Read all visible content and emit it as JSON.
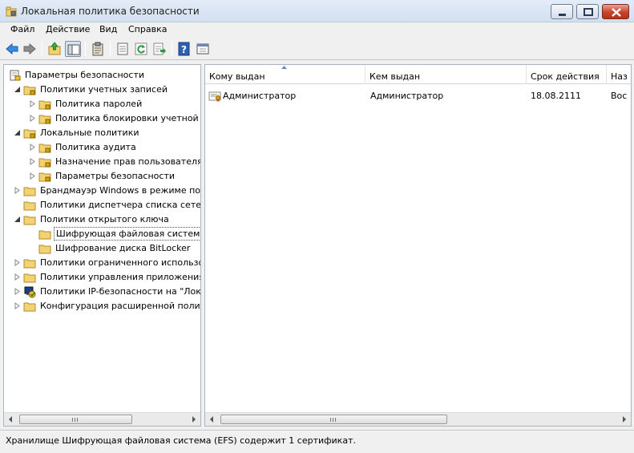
{
  "window": {
    "title": "Локальная политика безопасности"
  },
  "menu": [
    {
      "label": "Файл"
    },
    {
      "label": "Действие"
    },
    {
      "label": "Вид"
    },
    {
      "label": "Справка"
    }
  ],
  "toolbar": {
    "icons": [
      "back-arrow-icon",
      "forward-arrow-icon",
      "up-folder-icon",
      "show-hide-tree-icon",
      "clipboard-icon",
      "properties-icon",
      "refresh-icon",
      "export-list-icon",
      "help-icon",
      "console-icon"
    ]
  },
  "tree": {
    "items": [
      {
        "label": "Параметры безопасности"
      },
      {
        "label": "Политики учетных записей"
      },
      {
        "label": "Политика паролей"
      },
      {
        "label": "Политика блокировки учетной з"
      },
      {
        "label": "Локальные политики"
      },
      {
        "label": "Политика аудита"
      },
      {
        "label": "Назначение прав пользователя"
      },
      {
        "label": "Параметры безопасности"
      },
      {
        "label": "Брандмауэр Windows в режиме пов"
      },
      {
        "label": "Политики диспетчера списка сетей"
      },
      {
        "label": "Политики открытого ключа"
      },
      {
        "label": "Шифрующая файловая система"
      },
      {
        "label": "Шифрование диска BitLocker"
      },
      {
        "label": "Политики ограниченного использо"
      },
      {
        "label": "Политики управления приложения"
      },
      {
        "label": "Политики IP-безопасности на \"Лока"
      },
      {
        "label": "Конфигурация расширенной полит"
      }
    ]
  },
  "list": {
    "columns": [
      {
        "label": "Кому выдан"
      },
      {
        "label": "Кем выдан"
      },
      {
        "label": "Срок действия"
      },
      {
        "label": "Наз"
      }
    ],
    "rows": [
      {
        "issued_to": "Администратор",
        "issued_by": "Администратор",
        "expires": "18.08.2111",
        "purpose": "Вос"
      }
    ]
  },
  "status": {
    "text": "Хранилище Шифрующая файловая система (EFS) содержит 1 сертификат."
  },
  "colors": {
    "folder": "#f2d271",
    "title_bar": "#dbe6f4",
    "accent": "#3a6ea5"
  }
}
